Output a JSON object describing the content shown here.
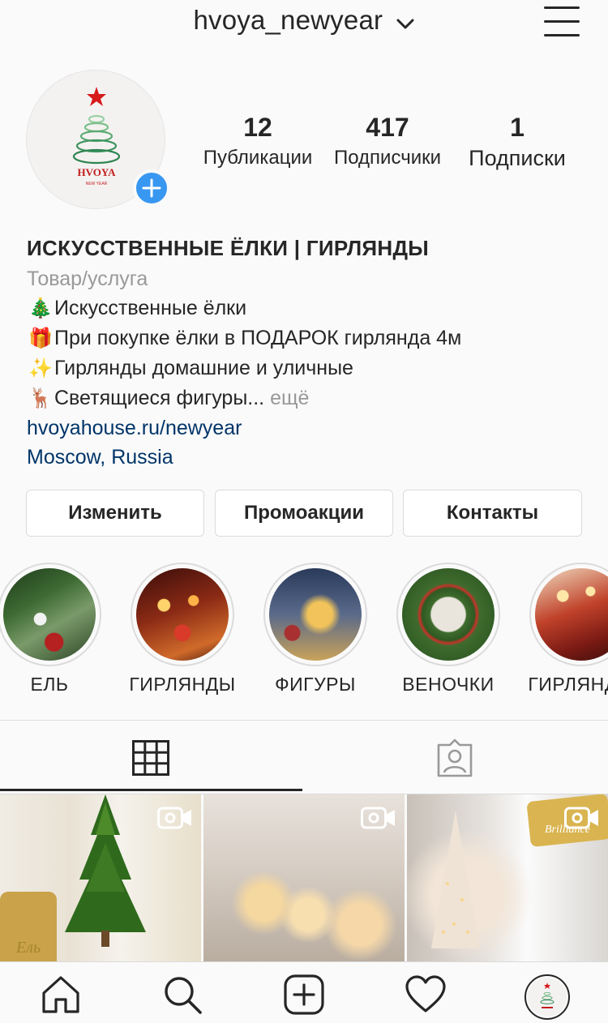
{
  "header": {
    "username": "hvoya_newyear",
    "menu_icon": "hamburger-menu-icon"
  },
  "profile": {
    "avatar_text": "HVOYA",
    "avatar_subtext": "NEW YEAR",
    "add_icon": "plus-icon"
  },
  "stats": [
    {
      "value": "12",
      "label": "Публикации"
    },
    {
      "value": "417",
      "label": "Подписчики"
    },
    {
      "value": "1",
      "label": "Подписки"
    }
  ],
  "bio": {
    "name": "ИСКУССТВЕННЫЕ ЁЛКИ | ГИРЛЯНДЫ",
    "category": "Товар/услуга",
    "lines": [
      {
        "emoji": "🎄",
        "text": "Искусственные ёлки"
      },
      {
        "emoji": "🎁",
        "text": "При покупке ёлки в ПОДАРОК гирлянда 4м"
      },
      {
        "emoji": "✨",
        "text": "Гирлянды домашние и уличные"
      },
      {
        "emoji": "🦌",
        "text": "Светящиеся фигуры...",
        "more": "ещё"
      }
    ],
    "website": "hvoyahouse.ru/newyear",
    "location": "Moscow, Russia"
  },
  "buttons": {
    "edit": "Изменить",
    "promo": "Промоакции",
    "contacts": "Контакты"
  },
  "highlights": [
    {
      "label": "ЕЛЬ"
    },
    {
      "label": "ГИРЛЯНДЫ"
    },
    {
      "label": "ФИГУРЫ"
    },
    {
      "label": "ВЕНОЧКИ"
    },
    {
      "label": "ГИРЛЯНДЫ"
    }
  ],
  "tabs": {
    "grid_icon": "grid-icon",
    "tagged_icon": "tagged-person-icon",
    "active": "grid"
  },
  "posts": [
    {
      "caption": "Ель",
      "type": "video"
    },
    {
      "caption": "",
      "type": "video"
    },
    {
      "caption": "Brilliance",
      "type": "video"
    }
  ],
  "bottom_nav": [
    "home-icon",
    "search-icon",
    "new-post-icon",
    "activity-heart-icon",
    "profile-avatar"
  ],
  "colors": {
    "accent_blue": "#3897f0",
    "link": "#003569",
    "muted": "#999999",
    "border": "#dbdbdb"
  }
}
